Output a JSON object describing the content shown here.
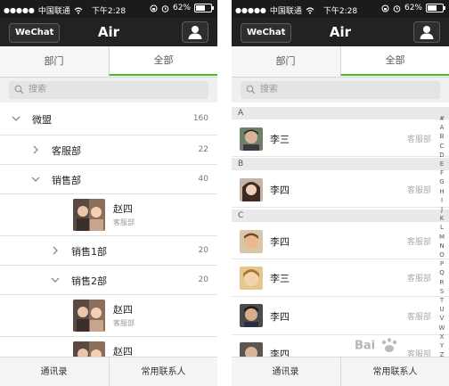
{
  "status_bar": {
    "carrier": "中国联通",
    "time": "下午2:28",
    "battery": "62%",
    "battery_level": 0.62
  },
  "nav": {
    "back_label": "WeChat",
    "title": "Air",
    "contact_icon": "person-icon"
  },
  "left": {
    "tabs": [
      {
        "label": "部门",
        "active": true
      },
      {
        "label": "全部",
        "active": false
      }
    ],
    "search_placeholder": "搜索",
    "tree": {
      "root": {
        "label": "微盟",
        "count": "160"
      },
      "kefu": {
        "label": "客服部",
        "count": "22"
      },
      "xiaoshou": {
        "label": "销售部",
        "count": "40"
      },
      "person1": {
        "name": "赵四",
        "dept": "客服部"
      },
      "xs1": {
        "label": "销售1部",
        "count": "20"
      },
      "xs2": {
        "label": "销售2部",
        "count": "20"
      },
      "person2": {
        "name": "赵四",
        "dept": "客服部"
      },
      "person3": {
        "name": "赵四"
      }
    },
    "bottom": [
      "通讯录",
      "常用联系人"
    ]
  },
  "right": {
    "tabs": [
      {
        "label": "部门",
        "active": false
      },
      {
        "label": "全部",
        "active": true
      }
    ],
    "search_placeholder": "搜索",
    "sections": {
      "a": {
        "letter": "A",
        "contact": {
          "name": "李三",
          "dept": "客服部"
        }
      },
      "b": {
        "letter": "B",
        "contact": {
          "name": "李四",
          "dept": "客服部"
        }
      },
      "c": {
        "letter": "C",
        "c1": {
          "name": "李四",
          "dept": "客服部"
        },
        "c2": {
          "name": "李三",
          "dept": "客服部"
        },
        "c3": {
          "name": "李四",
          "dept": "客服部"
        },
        "c4": {
          "name": "李四",
          "dept": "客服部"
        }
      }
    },
    "index_letters": [
      "#",
      "A",
      "B",
      "C",
      "D",
      "E",
      "F",
      "G",
      "H",
      "I",
      "J",
      "K",
      "L",
      "M",
      "N",
      "O",
      "P",
      "Q",
      "R",
      "S",
      "T",
      "U",
      "V",
      "W",
      "X",
      "Y",
      "Z"
    ],
    "bottom": [
      "通讯录",
      "常用联系人"
    ],
    "watermark": "Bai"
  },
  "colors": {
    "accent_green": "#45c01a",
    "navbar": "#222222",
    "statusbar": "#1b1b1b"
  }
}
